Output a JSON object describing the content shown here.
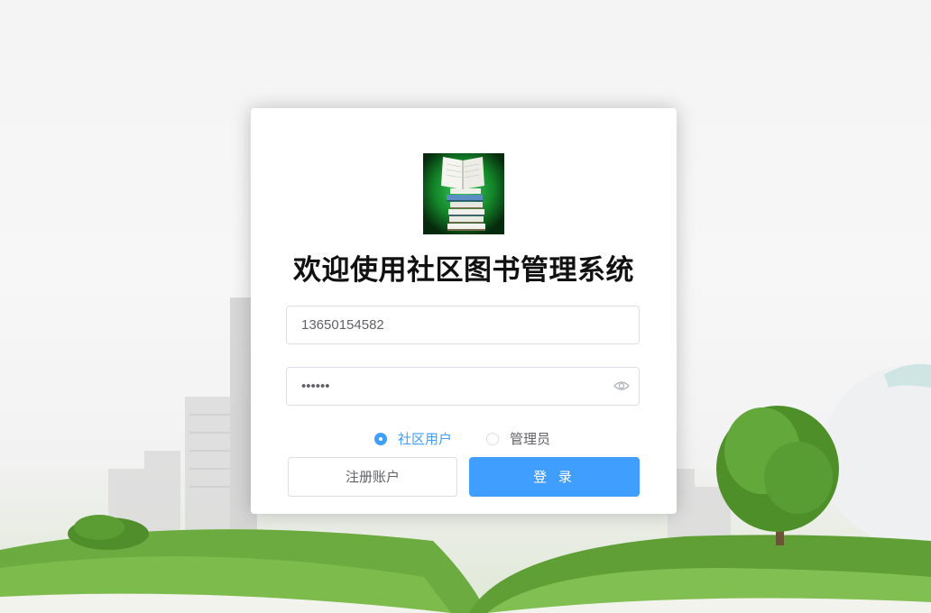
{
  "app": {
    "title": "欢迎使用社区图书管理系统"
  },
  "form": {
    "phone_value": "13650154582",
    "password_value": "123456"
  },
  "roles": {
    "options": [
      "社区用户",
      "管理员"
    ],
    "selected": "社区用户"
  },
  "buttons": {
    "register_label": "注册账户",
    "login_label": "登 录"
  },
  "icons": {
    "password_toggle": "eye-icon",
    "logo": "book-stack-logo"
  },
  "colors": {
    "primary": "#409eff",
    "border": "#dcdfe6",
    "text": "#606266"
  }
}
